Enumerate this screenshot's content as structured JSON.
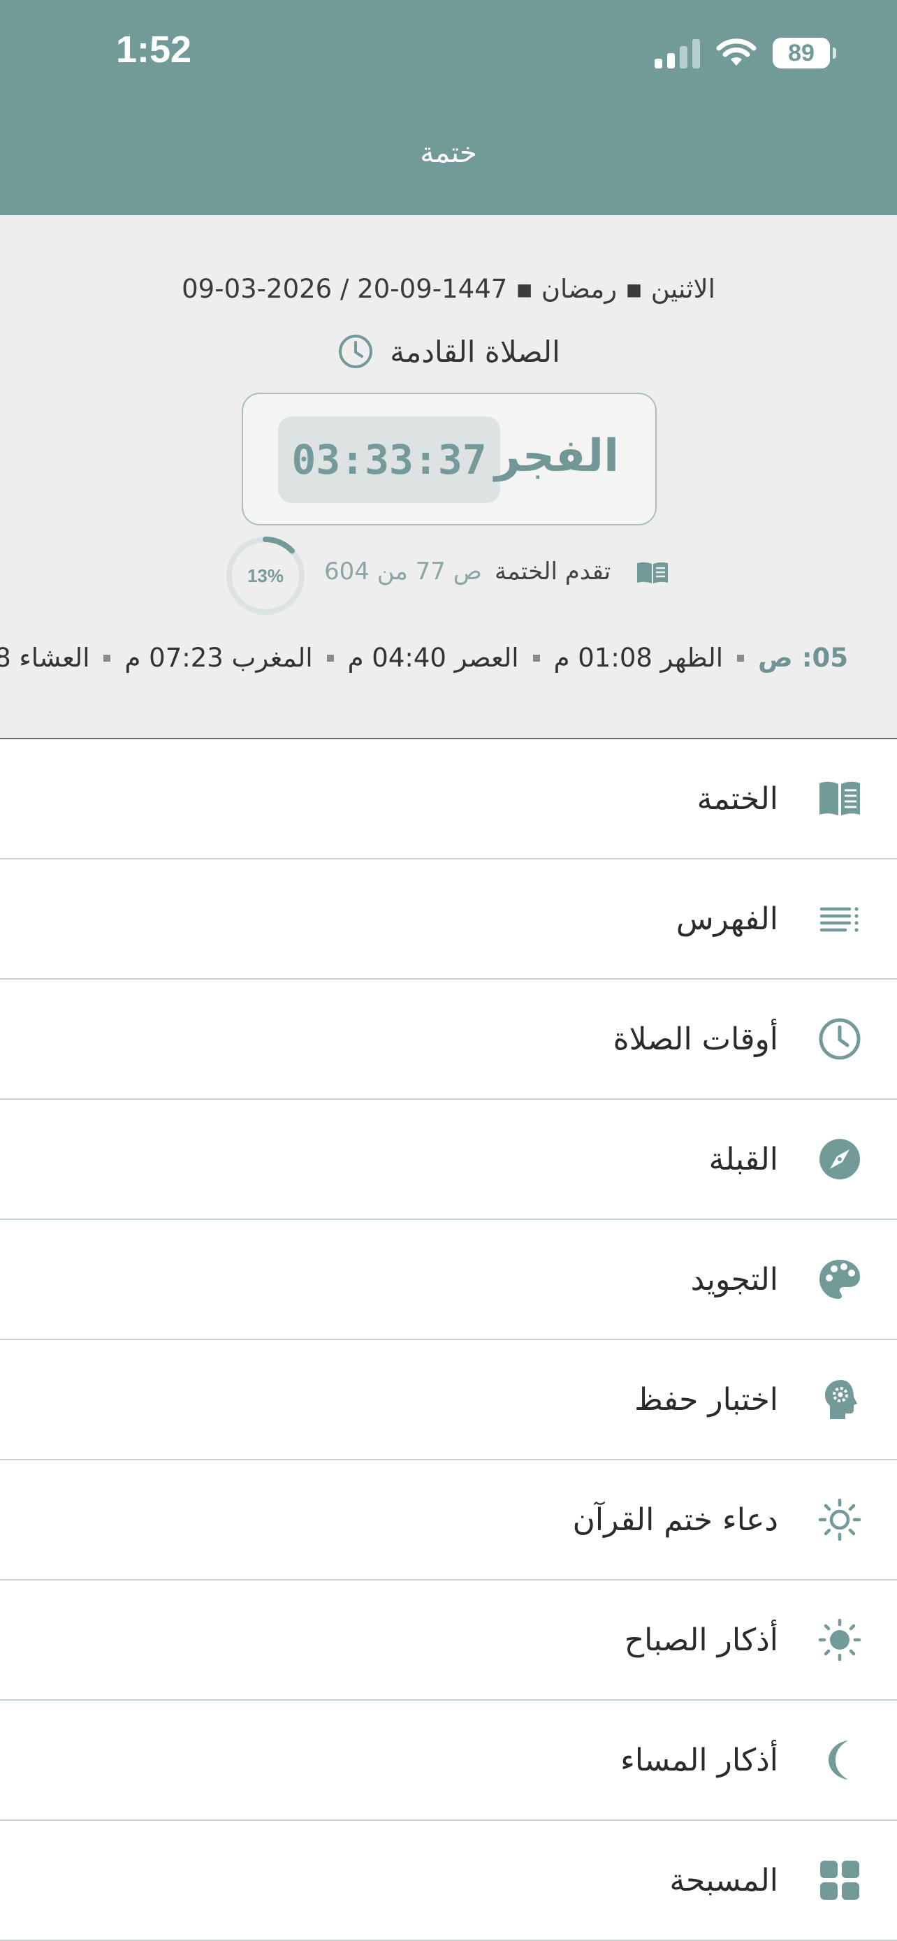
{
  "status": {
    "time": "1:52",
    "battery": "89"
  },
  "header": {
    "title": "ختمة"
  },
  "info": {
    "date": "الاثنين ▪ رمضان ▪ 1447-09-20  /  2026-03-09",
    "next_prayer_label": "الصلاة القادمة",
    "next_prayer_name": "الفجر",
    "countdown": "03:33:37",
    "progress_label": "تقدم الختمة",
    "progress_pages": "ص 77 من 604",
    "progress_percent": "13%",
    "progress_value": 0.13,
    "prayer_times": [
      {
        "label": "05: ص"
      },
      {
        "label": "الظهر 01:08 م"
      },
      {
        "label": "العصر 04:40 م"
      },
      {
        "label": "المغرب 07:23 م"
      },
      {
        "label": "العشاء 8"
      }
    ]
  },
  "menu": {
    "items": [
      {
        "label": "الختمة",
        "icon": "book-open-icon"
      },
      {
        "label": "الفهرس",
        "icon": "list-icon"
      },
      {
        "label": "أوقات الصلاة",
        "icon": "clock-icon"
      },
      {
        "label": "القبلة",
        "icon": "compass-icon"
      },
      {
        "label": "التجويد",
        "icon": "palette-icon"
      },
      {
        "label": "اختبار حفظ",
        "icon": "head-gear-icon"
      },
      {
        "label": "دعاء ختم القرآن",
        "icon": "sun-outline-icon"
      },
      {
        "label": "أذكار الصباح",
        "icon": "sun-icon"
      },
      {
        "label": "أذكار المساء",
        "icon": "moon-icon"
      },
      {
        "label": "المسبحة",
        "icon": "grid-icon"
      }
    ]
  },
  "colors": {
    "accent": "#729a99",
    "panel": "#eeeeee"
  }
}
